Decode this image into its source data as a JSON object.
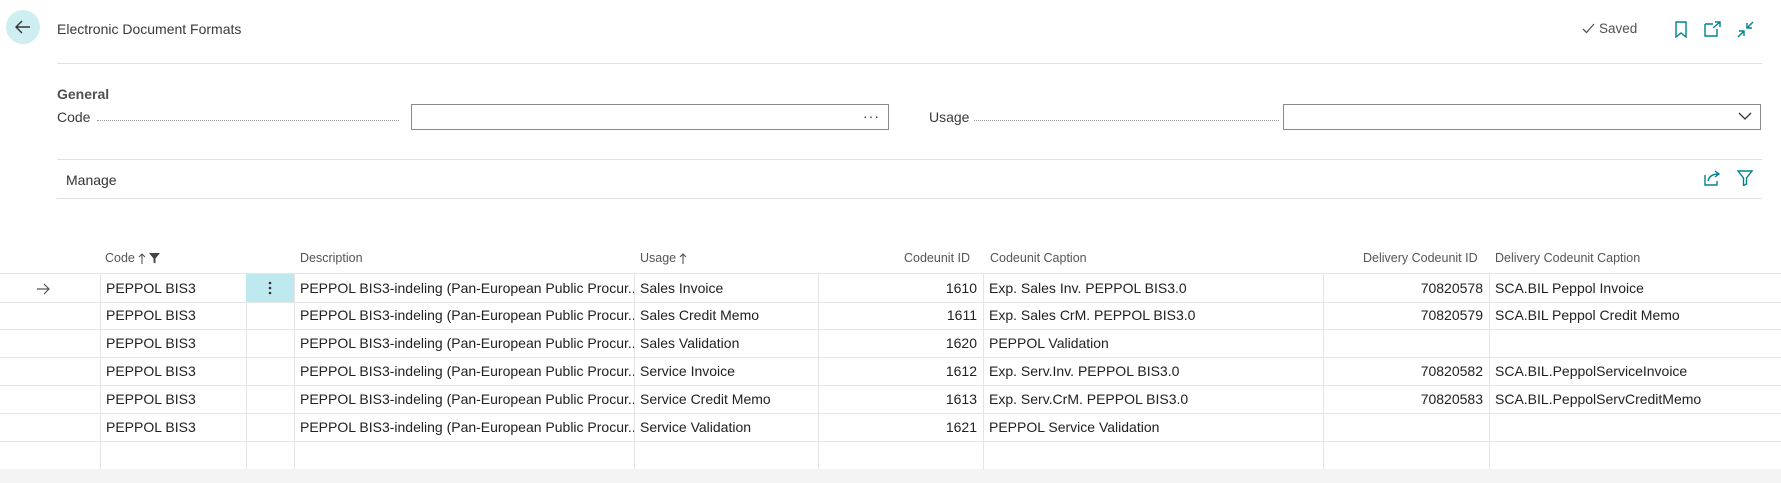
{
  "header": {
    "title": "Electronic Document Formats",
    "saved_label": "Saved"
  },
  "general": {
    "section_title": "General",
    "code_label": "Code",
    "code_value": "",
    "usage_label": "Usage",
    "usage_value": ""
  },
  "manage": {
    "label": "Manage"
  },
  "columns": {
    "code": "Code",
    "description": "Description",
    "usage": "Usage",
    "codeunit_id": "Codeunit ID",
    "codeunit_caption": "Codeunit Caption",
    "delivery_codeunit_id": "Delivery Codeunit ID",
    "delivery_codeunit_caption": "Delivery Codeunit Caption"
  },
  "rows": [
    {
      "code": "PEPPOL BIS3",
      "description": "PEPPOL BIS3-indeling (Pan-European Public Procur...",
      "usage": "Sales Invoice",
      "codeunit_id": "1610",
      "codeunit_caption": "Exp. Sales Inv. PEPPOL BIS3.0",
      "delivery_codeunit_id": "70820578",
      "delivery_codeunit_caption": "SCA.BIL Peppol Invoice"
    },
    {
      "code": "PEPPOL BIS3",
      "description": "PEPPOL BIS3-indeling (Pan-European Public Procur...",
      "usage": "Sales Credit Memo",
      "codeunit_id": "1611",
      "codeunit_caption": "Exp. Sales CrM. PEPPOL BIS3.0",
      "delivery_codeunit_id": "70820579",
      "delivery_codeunit_caption": "SCA.BIL Peppol Credit Memo"
    },
    {
      "code": "PEPPOL BIS3",
      "description": "PEPPOL BIS3-indeling (Pan-European Public Procur...",
      "usage": "Sales Validation",
      "codeunit_id": "1620",
      "codeunit_caption": "PEPPOL Validation",
      "delivery_codeunit_id": "",
      "delivery_codeunit_caption": ""
    },
    {
      "code": "PEPPOL BIS3",
      "description": "PEPPOL BIS3-indeling (Pan-European Public Procur...",
      "usage": "Service Invoice",
      "codeunit_id": "1612",
      "codeunit_caption": "Exp. Serv.Inv. PEPPOL BIS3.0",
      "delivery_codeunit_id": "70820582",
      "delivery_codeunit_caption": "SCA.BIL.PeppolServiceInvoice"
    },
    {
      "code": "PEPPOL BIS3",
      "description": "PEPPOL BIS3-indeling (Pan-European Public Procur...",
      "usage": "Service Credit Memo",
      "codeunit_id": "1613",
      "codeunit_caption": "Exp. Serv.CrM. PEPPOL BIS3.0",
      "delivery_codeunit_id": "70820583",
      "delivery_codeunit_caption": "SCA.BIL.PeppolServCreditMemo"
    },
    {
      "code": "PEPPOL BIS3",
      "description": "PEPPOL BIS3-indeling (Pan-European Public Procur...",
      "usage": "Service Validation",
      "codeunit_id": "1621",
      "codeunit_caption": "PEPPOL Service Validation",
      "delivery_codeunit_id": "",
      "delivery_codeunit_caption": ""
    }
  ],
  "icons": {
    "back": "back-arrow-icon",
    "saved_check": "check-icon",
    "bookmark": "bookmark-icon",
    "open_new": "open-in-new-window-icon",
    "collapse": "collapse-icon",
    "share": "share-icon",
    "filter": "filter-icon",
    "row_arrow": "current-row-arrow-icon",
    "row_actions": "vertical-ellipsis-icon"
  },
  "colors": {
    "accent": "#00838f",
    "selection": "#bde9ef",
    "back_bg": "#cfeef2"
  }
}
